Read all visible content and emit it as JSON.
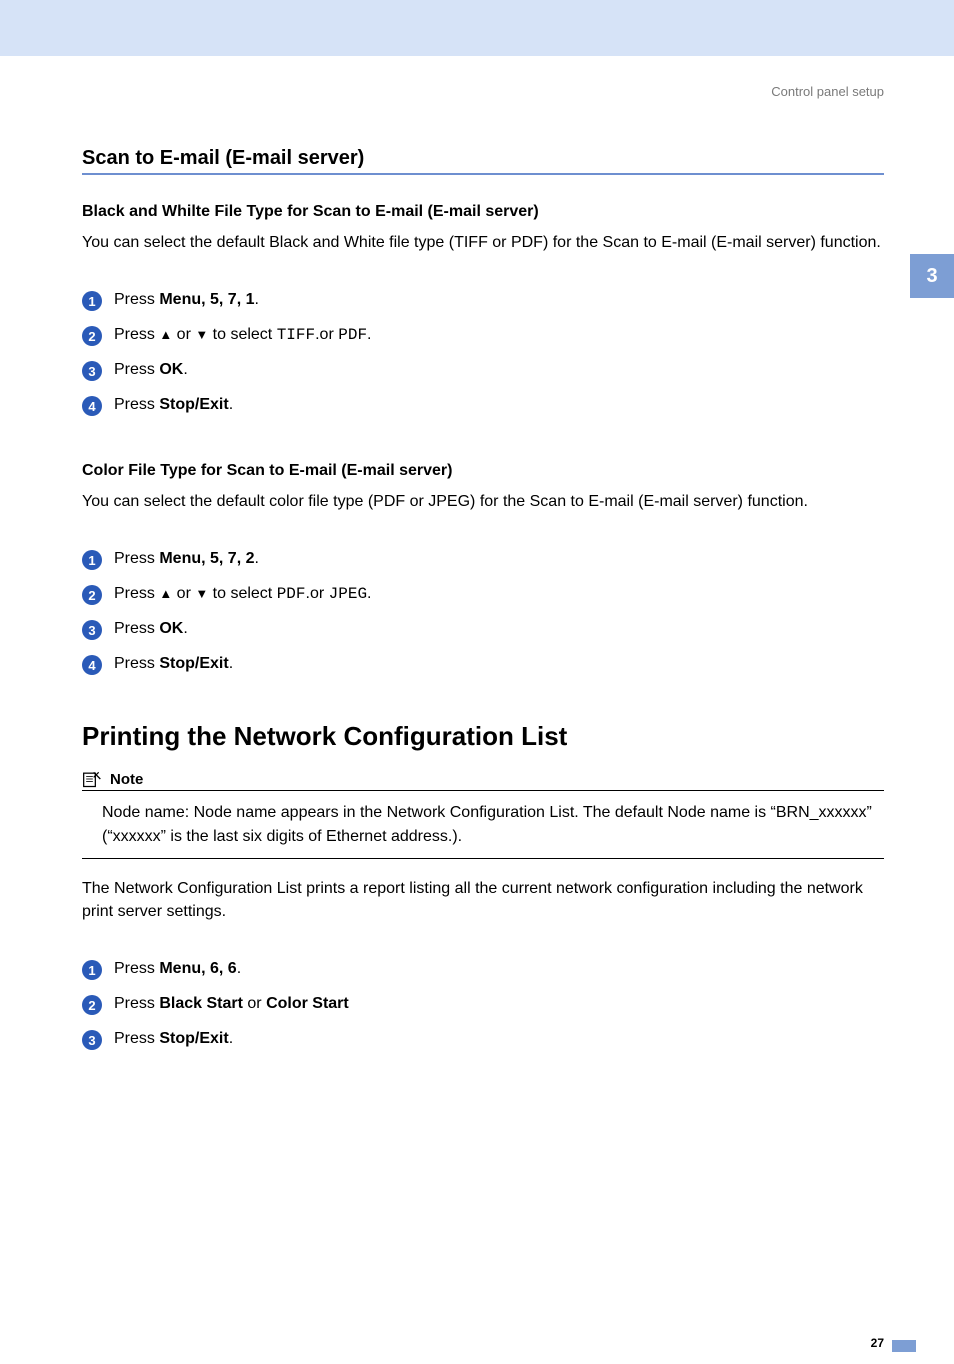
{
  "breadcrumb": "Control panel setup",
  "chapter_tab": "3",
  "section_title": "Scan to E-mail (E-mail server)",
  "bw": {
    "heading": "Black and Whilte File Type for Scan to E-mail (E-mail server)",
    "intro": "You can select the default Black and White file type (TIFF or PDF) for the Scan to E-mail (E-mail server) function.",
    "steps": {
      "s1": {
        "n": "1",
        "press": "Press ",
        "menu": "Menu",
        "seq": ", 5, 7, 1",
        "dot": "."
      },
      "s2": {
        "n": "2",
        "prefix": "Press ",
        "mid": " or ",
        "suffix": " to select ",
        "opt1": "TIFF",
        "or": ".or ",
        "opt2": "PDF",
        "dot": "."
      },
      "s3": {
        "n": "3",
        "press": "Press ",
        "ok": "OK",
        "dot": "."
      },
      "s4": {
        "n": "4",
        "press": "Press ",
        "stop": "Stop/Exit",
        "dot": "."
      }
    }
  },
  "color": {
    "heading": "Color File Type for Scan to E-mail (E-mail server)",
    "intro": "You can select the default color file type (PDF or JPEG) for the Scan to E-mail (E-mail server) function.",
    "steps": {
      "s1": {
        "n": "1",
        "press": "Press ",
        "menu": "Menu",
        "seq": ", 5, 7, 2",
        "dot": "."
      },
      "s2": {
        "n": "2",
        "prefix": "Press ",
        "mid": " or ",
        "suffix": " to select ",
        "opt1": "PDF",
        "or": ".or ",
        "opt2": "JPEG",
        "dot": "."
      },
      "s3": {
        "n": "3",
        "press": "Press ",
        "ok": "OK",
        "dot": "."
      },
      "s4": {
        "n": "4",
        "press": "Press ",
        "stop": "Stop/Exit",
        "dot": "."
      }
    }
  },
  "ncl": {
    "title": "Printing the Network Configuration List",
    "note_label": "Note",
    "note_body": "Node name: Node name appears in the Network Configuration List. The default Node name is “BRN_xxxxxx” (“xxxxxx” is the last six digits of Ethernet address.).",
    "intro": "The Network Configuration List prints a report listing all the current network configuration including the network print server settings.",
    "steps": {
      "s1": {
        "n": "1",
        "press": "Press ",
        "menu": "Menu",
        "seq": ", 6, 6",
        "dot": "."
      },
      "s2": {
        "n": "2",
        "press": "Press ",
        "bs": "Black Start",
        "or": " or ",
        "cs": "Color Start"
      },
      "s3": {
        "n": "3",
        "press": "Press ",
        "stop": "Stop/Exit",
        "dot": "."
      }
    }
  },
  "page_number": "27"
}
